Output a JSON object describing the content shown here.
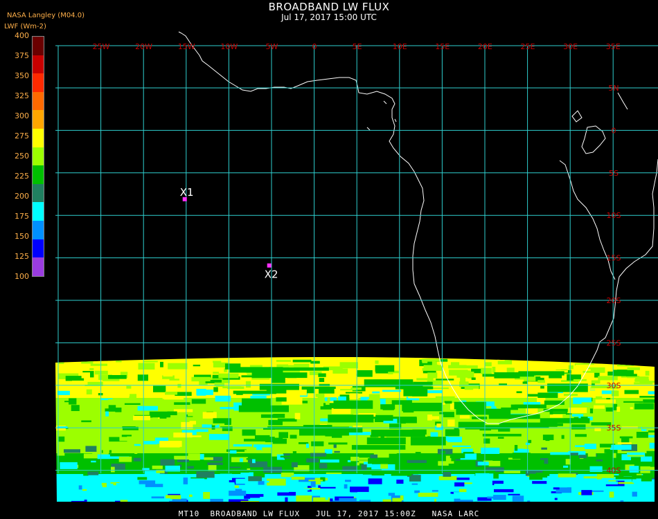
{
  "header": {
    "title": "BROADBAND LW FLUX",
    "subtitle": "Jul 17, 2017 15:00 UTC",
    "source": "NASA Langley (M04.0)",
    "units": "LWF (Wm-2)"
  },
  "colorbar": {
    "labels": [
      "400",
      "375",
      "350",
      "325",
      "300",
      "275",
      "250",
      "225",
      "200",
      "175",
      "150",
      "125",
      "100"
    ],
    "colors": [
      "#6a0000",
      "#c80000",
      "#ff2a00",
      "#ff6a00",
      "#ffa600",
      "#ffff00",
      "#9cff00",
      "#00c000",
      "#208060",
      "#00ffff",
      "#0090ff",
      "#0000ff",
      "#9a3ce0"
    ]
  },
  "map": {
    "lon_labels": [
      "25W",
      "20W",
      "15W",
      "10W",
      "5W",
      "0",
      "5E",
      "10E",
      "15E",
      "20E",
      "25E",
      "30E",
      "35E"
    ],
    "lat_labels": [
      "5N",
      "0",
      "5S",
      "10S",
      "15S",
      "20S",
      "25S",
      "30S",
      "35S",
      "40S"
    ],
    "grid_color": "#2fd0d0",
    "label_color": "#c80000",
    "markers": [
      {
        "label": "X1",
        "lon": -15.2,
        "lat": -8.1
      },
      {
        "label": "X2",
        "lon": -5.3,
        "lat": -15.9
      }
    ],
    "marker_color": "#ff30ff"
  },
  "footer": "MT10  BROADBAND LW FLUX   JUL 17, 2017 15:00Z   NASA LARC"
}
